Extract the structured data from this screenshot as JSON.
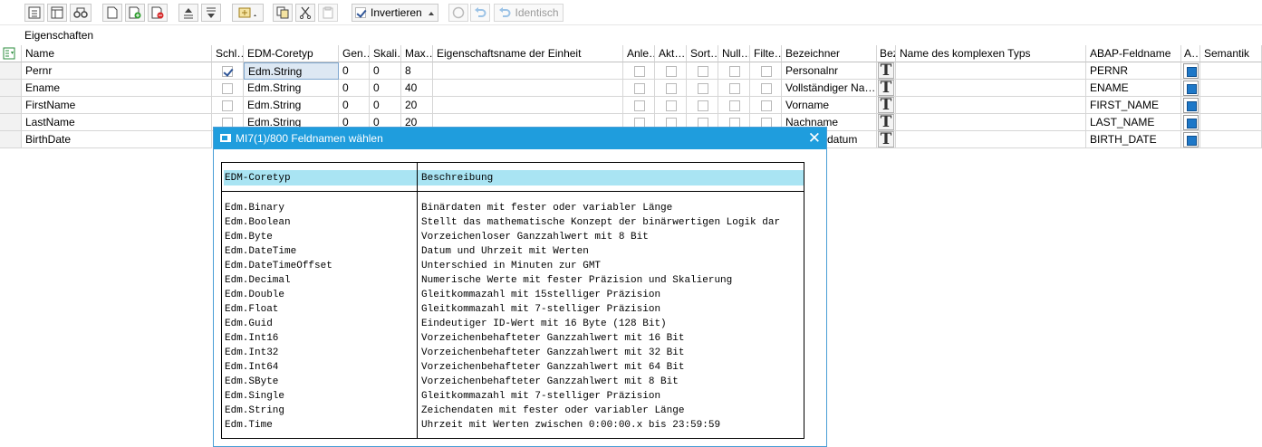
{
  "toolbar": {
    "invert_label": "Invertieren",
    "identical_label": "Identisch"
  },
  "section_title": "Eigenschaften",
  "table": {
    "headers": [
      "Name",
      "Schl…",
      "EDM-Coretyp",
      "Gen…",
      "Skali…",
      "Max…",
      "Eigenschaftsname der Einheit",
      "Anle…",
      "Akt…",
      "Sort…",
      "Null…",
      "Filte…",
      "Bezeichner",
      "Bez",
      "Name des komplexen Typs",
      "ABAP-Feldname",
      "A…",
      "Semantik"
    ],
    "rows": [
      {
        "name": "Pernr",
        "key": true,
        "type": "Edm.String",
        "gen": "0",
        "scale": "0",
        "max": "8",
        "label": "Personalnr",
        "abap": "PERNR"
      },
      {
        "name": "Ename",
        "key": false,
        "type": "Edm.String",
        "gen": "0",
        "scale": "0",
        "max": "40",
        "label": "Vollständiger Na…",
        "abap": "ENAME"
      },
      {
        "name": "FirstName",
        "key": false,
        "type": "Edm.String",
        "gen": "0",
        "scale": "0",
        "max": "20",
        "label": "Vorname",
        "abap": "FIRST_NAME"
      },
      {
        "name": "LastName",
        "key": false,
        "type": "Edm.String",
        "gen": "0",
        "scale": "0",
        "max": "20",
        "label": "Nachname",
        "abap": "LAST_NAME"
      },
      {
        "name": "BirthDate",
        "key": false,
        "type": "",
        "gen": "",
        "scale": "",
        "max": "",
        "label": "datum",
        "abap": "BIRTH_DATE"
      }
    ]
  },
  "dialog": {
    "title": "MI7(1)/800 Feldnamen wählen",
    "col1_header": "EDM-Coretyp",
    "col2_header": "Beschreibung",
    "items": [
      {
        "type": "Edm.Binary",
        "desc": "Binärdaten mit fester oder variabler Länge"
      },
      {
        "type": "Edm.Boolean",
        "desc": "Stellt das mathematische Konzept der binärwertigen Logik dar"
      },
      {
        "type": "Edm.Byte",
        "desc": "Vorzeichenloser Ganzzahlwert mit 8 Bit"
      },
      {
        "type": "Edm.DateTime",
        "desc": "Datum und Uhrzeit mit Werten"
      },
      {
        "type": "Edm.DateTimeOffset",
        "desc": "Unterschied in Minuten zur GMT"
      },
      {
        "type": "Edm.Decimal",
        "desc": "Numerische Werte mit fester Präzision und Skalierung"
      },
      {
        "type": "Edm.Double",
        "desc": "Gleitkommazahl mit 15stelliger Präzision"
      },
      {
        "type": "Edm.Float",
        "desc": "Gleitkommazahl mit 7-stelliger Präzision"
      },
      {
        "type": "Edm.Guid",
        "desc": "Eindeutiger ID-Wert mit 16 Byte (128 Bit)"
      },
      {
        "type": "Edm.Int16",
        "desc": "Vorzeichenbehafteter Ganzzahlwert mit 16 Bit"
      },
      {
        "type": "Edm.Int32",
        "desc": "Vorzeichenbehafteter Ganzzahlwert mit 32 Bit"
      },
      {
        "type": "Edm.Int64",
        "desc": "Vorzeichenbehafteter Ganzzahlwert mit 64 Bit"
      },
      {
        "type": "Edm.SByte",
        "desc": "Vorzeichenbehafteter Ganzzahlwert mit 8 Bit"
      },
      {
        "type": "Edm.Single",
        "desc": "Gleitkommazahl mit 7-stelliger Präzision"
      },
      {
        "type": "Edm.String",
        "desc": "Zeichendaten mit fester oder variabler Länge"
      },
      {
        "type": "Edm.Time",
        "desc": "Uhrzeit mit Werten zwischen 0:00:00.x bis 23:59:59"
      }
    ]
  }
}
